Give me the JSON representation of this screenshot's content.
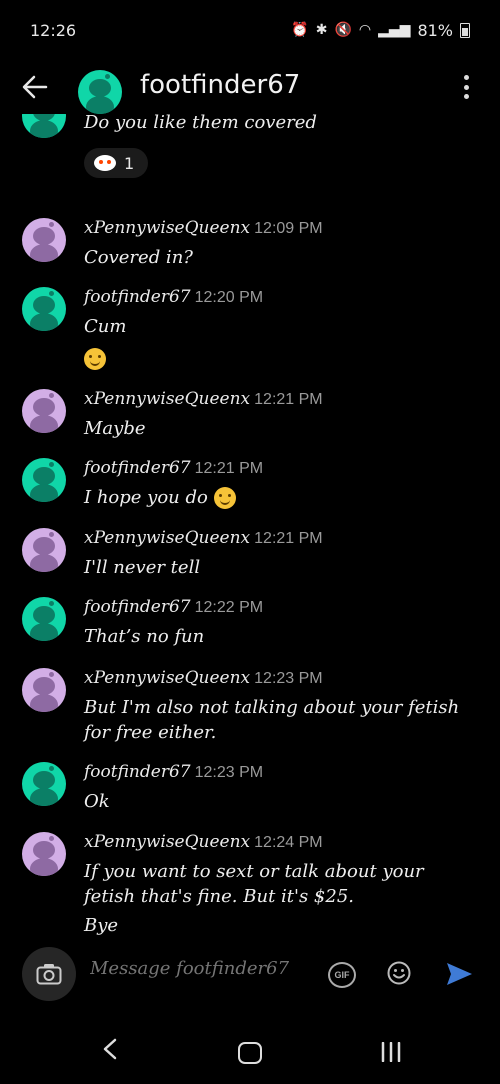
{
  "status": {
    "time": "12:26",
    "battery": "81%"
  },
  "header": {
    "title": "footfinder67"
  },
  "messages": [
    {
      "user": "",
      "time": "",
      "avatar": "teal",
      "lines": [
        "Do you like them covered"
      ]
    },
    {
      "user": "xPennywiseQueenx",
      "time": "12:09 PM",
      "avatar": "lavender",
      "lines": [
        "Covered in?"
      ]
    },
    {
      "user": "footfinder67",
      "time": "12:20 PM",
      "avatar": "teal",
      "lines": [
        "Cum"
      ]
    },
    {
      "user": "xPennywiseQueenx",
      "time": "12:21 PM",
      "avatar": "lavender",
      "lines": [
        "Maybe"
      ]
    },
    {
      "user": "footfinder67",
      "time": "12:21 PM",
      "avatar": "teal",
      "lines": [
        "I hope you do"
      ]
    },
    {
      "user": "xPennywiseQueenx",
      "time": "12:21 PM",
      "avatar": "lavender",
      "lines": [
        "I'll never tell"
      ]
    },
    {
      "user": "footfinder67",
      "time": "12:22 PM",
      "avatar": "teal",
      "lines": [
        "That’s no fun"
      ]
    },
    {
      "user": "xPennywiseQueenx",
      "time": "12:23 PM",
      "avatar": "lavender",
      "lines": [
        "But I'm also not talking about your fetish",
        "for free either."
      ]
    },
    {
      "user": "footfinder67",
      "time": "12:23 PM",
      "avatar": "teal",
      "lines": [
        "Ok"
      ]
    },
    {
      "user": "xPennywiseQueenx",
      "time": "12:24 PM",
      "avatar": "lavender",
      "lines": [
        "If you want to sext or talk about your",
        "fetish that's fine. But it's $25.",
        "Bye"
      ]
    }
  ],
  "reaction": {
    "emoji": "reddit-snoo",
    "count": "1"
  },
  "composer": {
    "placeholder": "Message footfinder67",
    "gif_label": "GIF"
  },
  "colors": {
    "teal_avatar": "#10d6a8",
    "lavender_avatar": "#d2aee6",
    "send": "#3f7bd6"
  }
}
